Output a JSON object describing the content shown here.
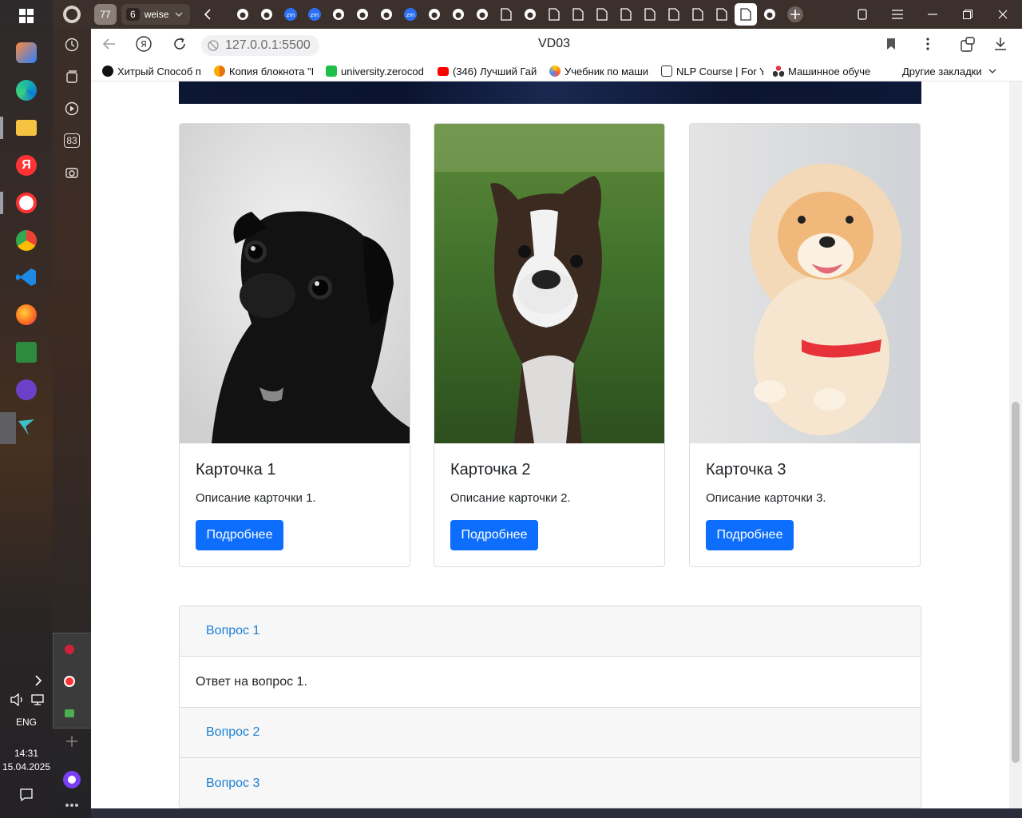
{
  "browser": {
    "tab_count": "77",
    "group": {
      "count": "6",
      "label": "weise"
    },
    "url": "127.0.0.1:5500",
    "page_title": "VD03",
    "bookmarks": [
      {
        "label": "Хитрый Способ п",
        "icon": "github-icon"
      },
      {
        "label": "Копия блокнота \"I",
        "icon": "colab-icon"
      },
      {
        "label": "university.zerocod",
        "icon": "zerocoder-icon"
      },
      {
        "label": "(346) Лучший Гай",
        "icon": "youtube-icon"
      },
      {
        "label": "Учебник по маши",
        "icon": "yandex-education-icon"
      },
      {
        "label": "NLP Course | For Y",
        "icon": "nlp-course-icon"
      },
      {
        "label": "Машинное обуче",
        "icon": "ml-icon"
      }
    ],
    "other_bookmarks": "Другие закладки"
  },
  "cards": [
    {
      "title": "Карточка 1",
      "text": "Описание карточки 1.",
      "button": "Подробнее",
      "image": "black-pug-photo"
    },
    {
      "title": "Карточка 2",
      "text": "Описание карточки 2.",
      "button": "Подробнее",
      "image": "boston-terrier-photo"
    },
    {
      "title": "Карточка 3",
      "text": "Описание карточки 3.",
      "button": "Подробнее",
      "image": "pomeranian-photo"
    }
  ],
  "accordion": [
    {
      "question": "Вопрос 1",
      "answer": "Ответ на вопрос 1.",
      "expanded": true
    },
    {
      "question": "Вопрос 2",
      "expanded": false
    },
    {
      "question": "Вопрос 3",
      "expanded": false
    }
  ],
  "system": {
    "language": "ENG",
    "time": "14:31",
    "date": "15.04.2025",
    "sidebar_badge": "83"
  },
  "colors": {
    "primary_button": "#0d6efd",
    "accordion_link": "#1a7fd4"
  }
}
